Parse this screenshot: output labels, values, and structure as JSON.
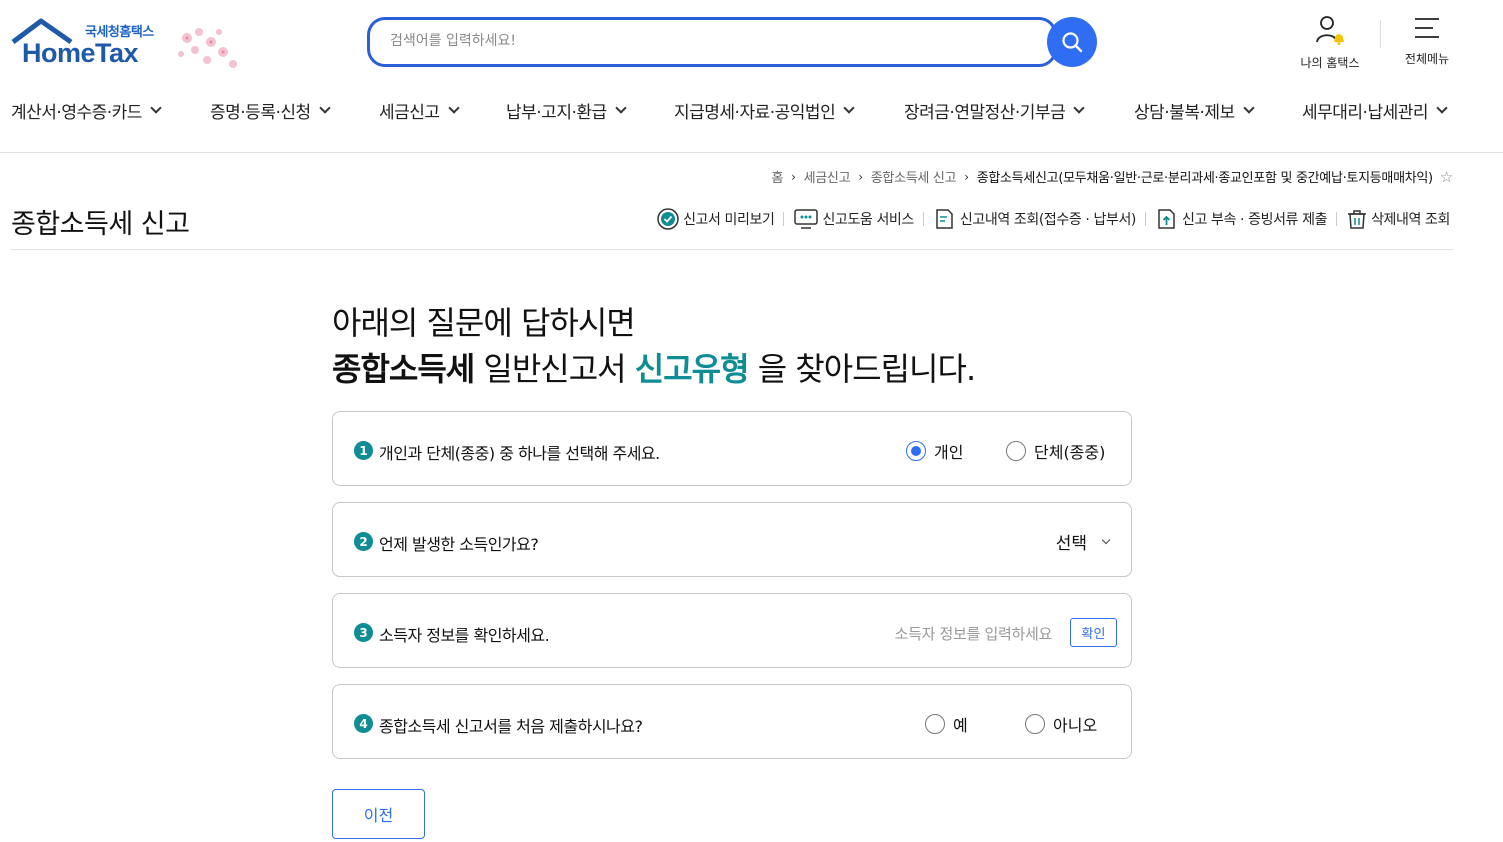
{
  "header": {
    "logo_sub": "국세청홈택스",
    "logo_main": "HomeTax",
    "search_placeholder": "검색어를 입력하세요!",
    "my_hometax": "나의 홈택스",
    "all_menu": "전체메뉴"
  },
  "nav": [
    "계산서·영수증·카드",
    "증명·등록·신청",
    "세금신고",
    "납부·고지·환급",
    "지급명세·자료·공익법인",
    "장려금·연말정산·기부금",
    "상담·불복·제보",
    "세무대리·납세관리"
  ],
  "breadcrumb": {
    "home": "홈",
    "level1": "세금신고",
    "level2": "종합소득세 신고",
    "current": "종합소득세신고(모두채움·일반·근로·분리과세·종교인포함 및 중간예납·토지등매매차익)"
  },
  "page_title": "종합소득세 신고",
  "toolbar": {
    "preview": "신고서 미리보기",
    "help": "신고도움 서비스",
    "history": "신고내역 조회(접수증 · 납부서)",
    "attach": "신고 부속 · 증빙서류 제출",
    "deleted": "삭제내역 조회"
  },
  "headline": {
    "line1": "아래의 질문에 답하시면",
    "bold": "종합소득세",
    "mid": " 일반신고서 ",
    "teal": "신고유형",
    "end": " 을 찾아드립니다."
  },
  "questions": {
    "q1": {
      "num": "1",
      "text": "개인과 단체(종중) 중 하나를 선택해 주세요.",
      "opt1": "개인",
      "opt2": "단체(종중)",
      "selected": "개인"
    },
    "q2": {
      "num": "2",
      "text": "언제 발생한 소득인가요?",
      "select": "선택"
    },
    "q3": {
      "num": "3",
      "text": "소득자 정보를 확인하세요.",
      "placeholder": "소득자 정보를 입력하세요",
      "button": "확인"
    },
    "q4": {
      "num": "4",
      "text": "종합소득세 신고서를 처음 제출하시나요?",
      "opt1": "예",
      "opt2": "아니오"
    }
  },
  "prev_button": "이전",
  "colors": {
    "primary": "#2f6ef3",
    "teal": "#0e8d94",
    "logo_blue": "#1f5aa8"
  }
}
